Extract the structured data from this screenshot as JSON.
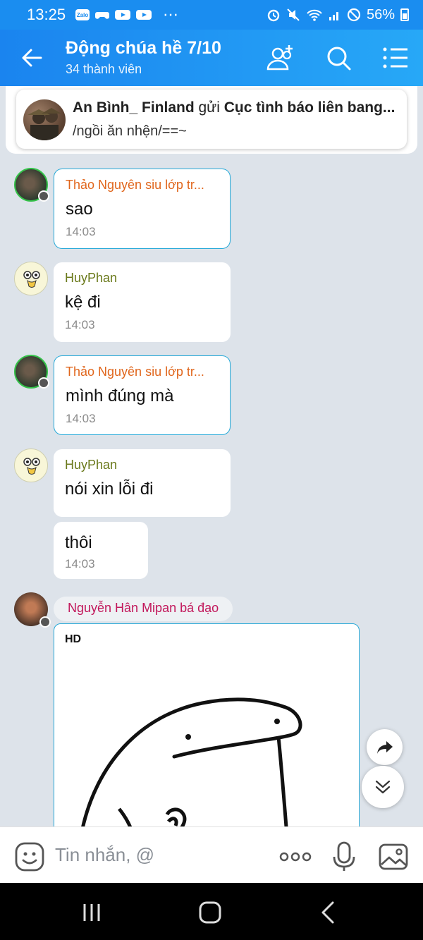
{
  "status_bar": {
    "time": "13:25",
    "app_icon_label": "Zalo",
    "more": "⋯",
    "battery": "56%"
  },
  "header": {
    "title": "Động chúa hề 7/10",
    "subtitle": "34 thành viên"
  },
  "pinned": {
    "sender": "An Bình_ Finland",
    "verb": " gửi ",
    "target": "Cục tình báo liên bang...",
    "text": "/ngồi ăn nhện/==~"
  },
  "messages": [
    {
      "sender": "Thảo Nguyên siu lớp tr...",
      "text": "sao",
      "time": "14:03"
    },
    {
      "sender": "HuyPhan",
      "text": "kệ đi",
      "time": "14:03"
    },
    {
      "sender": "Thảo Nguyên siu lớp tr...",
      "text": "mình đúng mà",
      "time": "14:03"
    },
    {
      "sender": "HuyPhan",
      "text": "nói xin lỗi đi",
      "time": null
    },
    {
      "sender": null,
      "text": "thôi",
      "time": "14:03"
    }
  ],
  "image_message": {
    "sender": "Nguyễn Hân Mipan bá đạo",
    "quality": "HD"
  },
  "input": {
    "placeholder": "Tin nhắn, @"
  },
  "colors": {
    "header_blue": "#1a84ef",
    "bubble_outline": "#26a9d8",
    "chat_bg": "#dde3ea"
  }
}
